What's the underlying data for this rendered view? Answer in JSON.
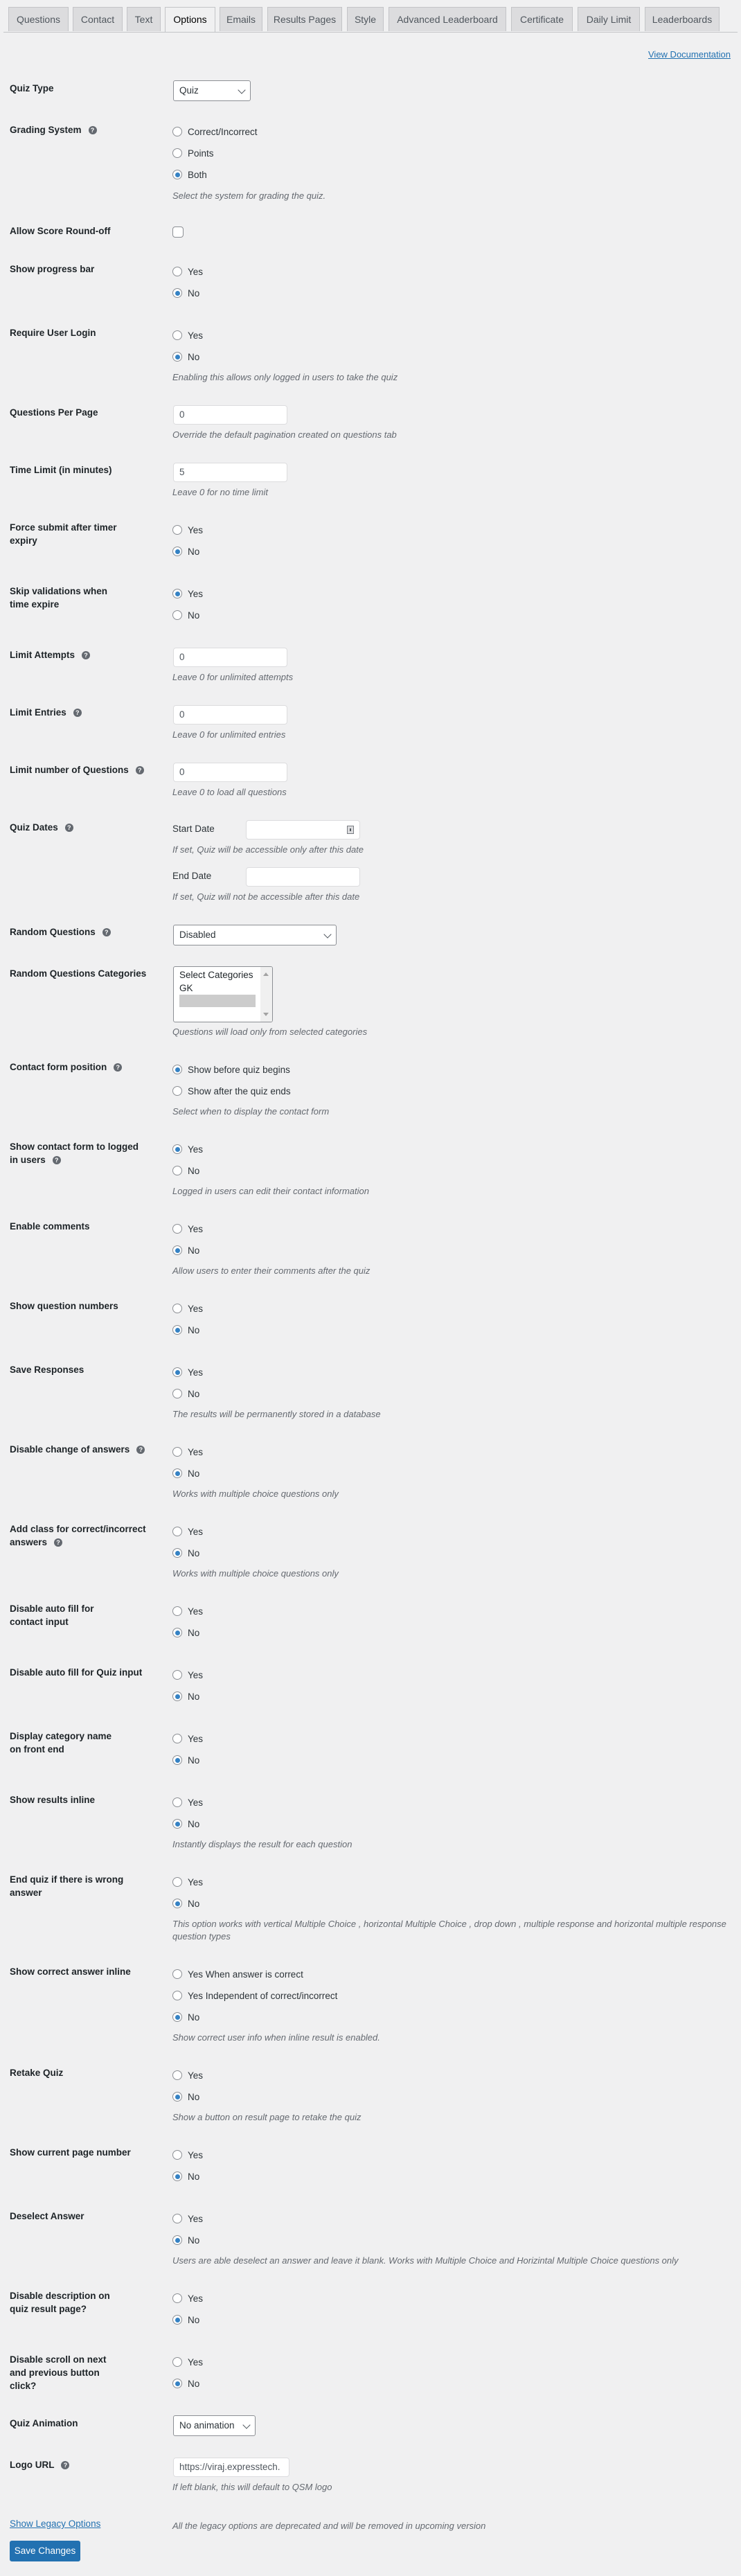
{
  "tabs": [
    {
      "label": "Questions",
      "active": false
    },
    {
      "label": "Contact",
      "active": false
    },
    {
      "label": "Text",
      "active": false
    },
    {
      "label": "Options",
      "active": true
    },
    {
      "label": "Emails",
      "active": false
    },
    {
      "label": "Results Pages",
      "active": false
    },
    {
      "label": "Style",
      "active": false
    },
    {
      "label": "Advanced Leaderboard",
      "active": false
    },
    {
      "label": "Certificate",
      "active": false
    },
    {
      "label": "Daily Limit",
      "active": false
    },
    {
      "label": "Leaderboards",
      "active": false
    }
  ],
  "doc_link": "View Documentation",
  "help_glyph": "?",
  "colors": {
    "accent": "#2271b1",
    "radio_checked": "#3582c4",
    "page_bg": "#f0f0f1"
  },
  "settings": {
    "quiz_type": {
      "label": "Quiz Type",
      "value": "Quiz"
    },
    "grading_system": {
      "label": "Grading System",
      "options": [
        "Correct/Incorrect",
        "Points",
        "Both"
      ],
      "selected": "Both",
      "desc": "Select the system for grading the quiz."
    },
    "allow_round_off": {
      "label": "Allow Score Round-off",
      "checked": false
    },
    "show_progress_bar": {
      "label": "Show progress bar",
      "options": [
        "Yes",
        "No"
      ],
      "selected": "No"
    },
    "require_login": {
      "label": "Require User Login",
      "options": [
        "Yes",
        "No"
      ],
      "selected": "No",
      "desc": "Enabling this allows only logged in users to take the quiz"
    },
    "questions_per_page": {
      "label": "Questions Per Page",
      "value": "0",
      "desc": "Override the default pagination created on questions tab"
    },
    "time_limit": {
      "label": "Time Limit (in minutes)",
      "value": "5",
      "desc": "Leave 0 for no time limit"
    },
    "force_submit": {
      "label": "Force submit after timer expiry",
      "options": [
        "Yes",
        "No"
      ],
      "selected": "No"
    },
    "skip_validations": {
      "label": "Skip validations when time expire",
      "options": [
        "Yes",
        "No"
      ],
      "selected": "Yes"
    },
    "limit_attempts": {
      "label": "Limit Attempts",
      "value": "0",
      "desc": "Leave 0 for unlimited attempts"
    },
    "limit_entries": {
      "label": "Limit Entries",
      "value": "0",
      "desc": "Leave 0 for unlimited entries"
    },
    "limit_questions": {
      "label": "Limit number of Questions",
      "value": "0",
      "desc": "Leave 0 to load all questions"
    },
    "quiz_dates": {
      "label": "Quiz Dates",
      "start_label": "Start Date",
      "start_value": "",
      "start_desc": "If set, Quiz will be accessible only after this date",
      "end_label": "End Date",
      "end_value": "",
      "end_desc": "If set, Quiz will not be accessible after this date"
    },
    "random_questions": {
      "label": "Random Questions",
      "value": "Disabled"
    },
    "random_categories": {
      "label": "Random Questions Categories",
      "options": [
        "Select Categories",
        "GK",
        ""
      ],
      "desc": "Questions will load only from selected categories"
    },
    "contact_position": {
      "label": "Contact form position",
      "options": [
        "Show before quiz begins",
        "Show after the quiz ends"
      ],
      "selected": "Show before quiz begins",
      "desc": "Select when to display the contact form"
    },
    "contact_logged_in": {
      "label": "Show contact form to logged in users",
      "options": [
        "Yes",
        "No"
      ],
      "selected": "Yes",
      "desc": "Logged in users can edit their contact information"
    },
    "enable_comments": {
      "label": "Enable comments",
      "options": [
        "Yes",
        "No"
      ],
      "selected": "No",
      "desc": "Allow users to enter their comments after the quiz"
    },
    "question_numbers": {
      "label": "Show question numbers",
      "options": [
        "Yes",
        "No"
      ],
      "selected": "No"
    },
    "save_responses": {
      "label": "Save Responses",
      "options": [
        "Yes",
        "No"
      ],
      "selected": "Yes",
      "desc": "The results will be permanently stored in a database"
    },
    "disable_change": {
      "label": "Disable change of answers",
      "options": [
        "Yes",
        "No"
      ],
      "selected": "No",
      "desc": "Works with multiple choice questions only"
    },
    "add_class": {
      "label": "Add class for correct/incorrect answers",
      "options": [
        "Yes",
        "No"
      ],
      "selected": "No",
      "desc": "Works with multiple choice questions only"
    },
    "autofill_contact": {
      "label": "Disable auto fill for contact input",
      "options": [
        "Yes",
        "No"
      ],
      "selected": "No"
    },
    "autofill_quiz": {
      "label": "Disable auto fill for Quiz input",
      "options": [
        "Yes",
        "No"
      ],
      "selected": "No"
    },
    "category_name": {
      "label": "Display category name on front end",
      "options": [
        "Yes",
        "No"
      ],
      "selected": "No"
    },
    "results_inline": {
      "label": "Show results inline",
      "options": [
        "Yes",
        "No"
      ],
      "selected": "No",
      "desc": "Instantly displays the result for each question"
    },
    "end_quiz_wrong": {
      "label": "End quiz if there is wrong answer",
      "options": [
        "Yes",
        "No"
      ],
      "selected": "No",
      "desc": "This option works with vertical Multiple Choice , horizontal Multiple Choice , drop down , multiple response and horizontal multiple response question types"
    },
    "correct_inline": {
      "label": "Show correct answer inline",
      "options": [
        "Yes When answer is correct",
        "Yes Independent of correct/incorrect",
        "No"
      ],
      "selected": "No",
      "desc": "Show correct user info when inline result is enabled."
    },
    "retake_quiz": {
      "label": "Retake Quiz",
      "options": [
        "Yes",
        "No"
      ],
      "selected": "No",
      "desc": "Show a button on result page to retake the quiz"
    },
    "current_page": {
      "label": "Show current page number",
      "options": [
        "Yes",
        "No"
      ],
      "selected": "No"
    },
    "deselect_answer": {
      "label": "Deselect Answer",
      "options": [
        "Yes",
        "No"
      ],
      "selected": "No",
      "desc": "Users are able deselect an answer and leave it blank. Works with Multiple Choice and Horizintal Multiple Choice questions only"
    },
    "disable_description": {
      "label": "Disable description on quiz result page?",
      "options": [
        "Yes",
        "No"
      ],
      "selected": "No"
    },
    "disable_scroll": {
      "label": "Disable scroll on next and previous button click?",
      "options": [
        "Yes",
        "No"
      ],
      "selected": "No"
    },
    "quiz_animation": {
      "label": "Quiz Animation",
      "value": "No animation"
    },
    "logo_url": {
      "label": "Logo URL",
      "value": "https://viraj.expresstech.",
      "desc": "If left blank, this will default to QSM logo"
    }
  },
  "legacy": {
    "link": "Show Legacy Options",
    "desc": "All the legacy options are deprecated and will be removed in upcoming version"
  },
  "save_button": "Save Changes"
}
